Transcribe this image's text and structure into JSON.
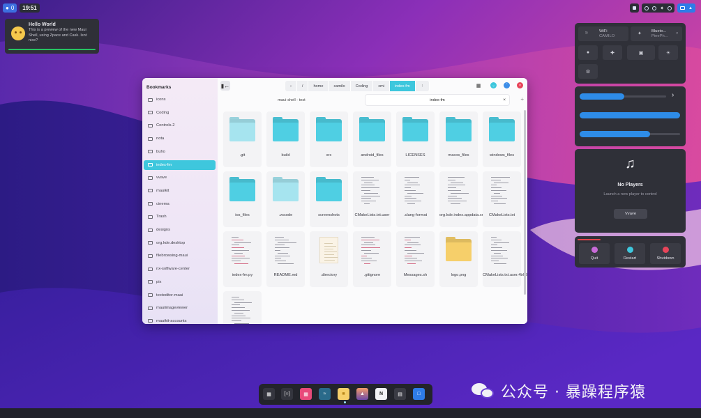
{
  "topbar": {
    "left_indicator": "0",
    "clock": "19:51"
  },
  "notification": {
    "title": "Hello World",
    "body": "This is a preview of the new Maui Shell, using Zpace and Cask. Isnt nice?"
  },
  "file_manager": {
    "sidebar": {
      "heading": "Bookmarks",
      "items": [
        {
          "label": "icons"
        },
        {
          "label": "Coding"
        },
        {
          "label": "Controls.2"
        },
        {
          "label": "nota"
        },
        {
          "label": "buho"
        },
        {
          "label": "index-fm",
          "active": true
        },
        {
          "label": "vvave"
        },
        {
          "label": "mauikit"
        },
        {
          "label": "cinema"
        },
        {
          "label": "Trash"
        },
        {
          "label": "designs"
        },
        {
          "label": "org.kde.desktop"
        },
        {
          "label": "filebrowsing-maui"
        },
        {
          "label": "nx-software-center"
        },
        {
          "label": "pix"
        },
        {
          "label": "texteditor-maui"
        },
        {
          "label": "mauiimageviewer"
        },
        {
          "label": "mauikit-accounts"
        }
      ]
    },
    "path": [
      "/",
      "home",
      "camilo",
      "Coding",
      "cmi",
      "index-fm"
    ],
    "tabs": [
      {
        "label": "maui-shell - test"
      },
      {
        "label": "index-fm",
        "active": true
      }
    ],
    "files": [
      {
        "name": ".git",
        "kind": "folder-light"
      },
      {
        "name": "build",
        "kind": "folder"
      },
      {
        "name": "src",
        "kind": "folder"
      },
      {
        "name": "android_files",
        "kind": "folder"
      },
      {
        "name": "LICENSES",
        "kind": "folder"
      },
      {
        "name": "macos_files",
        "kind": "folder"
      },
      {
        "name": "windows_files",
        "kind": "folder"
      },
      {
        "name": "ios_files",
        "kind": "folder"
      },
      {
        "name": ".vscode",
        "kind": "folder-light"
      },
      {
        "name": "screenshots",
        "kind": "folder"
      },
      {
        "name": "CMakeLists.txt.user",
        "kind": "doc"
      },
      {
        "name": ".clang-format",
        "kind": "doc"
      },
      {
        "name": "org.kde.index.appdata.xml",
        "kind": "doc"
      },
      {
        "name": "CMakeLists.txt",
        "kind": "doc"
      },
      {
        "name": "index-fm.py",
        "kind": "doc-red"
      },
      {
        "name": "README.md",
        "kind": "doc"
      },
      {
        "name": ".directory",
        "kind": "card"
      },
      {
        "name": ".gitignore",
        "kind": "doc-red"
      },
      {
        "name": "Messages.sh",
        "kind": "doc-red"
      },
      {
        "name": "logo.png",
        "kind": "folder-yellow"
      },
      {
        "name": "CMakeLists.txt.user.4b63894",
        "kind": "doc"
      },
      {
        "name": "",
        "kind": "doc"
      }
    ]
  },
  "quick_settings": {
    "wifi_title": "WiFi",
    "wifi_sub": "CAMILO",
    "bt_title": "Blueto...",
    "bt_sub": "PinePh..."
  },
  "sliders": {
    "volume": 0.52,
    "brightness": 1.0,
    "mic": 0.7
  },
  "player": {
    "title": "No Players",
    "subtitle": "Launch a new player to control",
    "button": "Vvave"
  },
  "power": {
    "quit": "Quit",
    "restart": "Restart",
    "shutdown": "Shutdown"
  },
  "colors": {
    "accent": "#3ec7dd",
    "folder": "#4fcfe3",
    "folder_light": "#a6e4ef",
    "folder_yellow": "#f6cf6a",
    "slider": "#2e8ce8"
  },
  "watermark": {
    "text": "公众号 · 暴躁程序猿"
  }
}
